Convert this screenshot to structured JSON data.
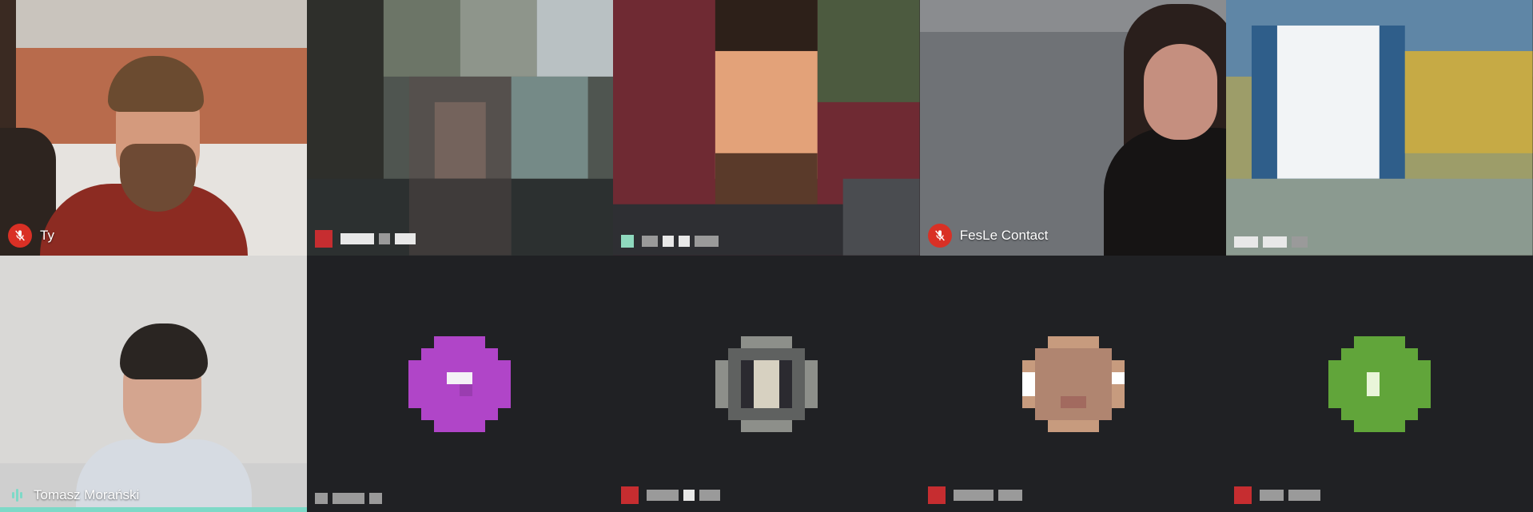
{
  "participants": [
    {
      "name": "Ty",
      "muted": true
    },
    {
      "name": "",
      "muted": true
    },
    {
      "name": "",
      "muted": false
    },
    {
      "name": "FesLe Contact",
      "muted": true
    },
    {
      "name": "",
      "muted": false
    },
    {
      "name": "Tomasz Morański",
      "muted": false,
      "speaking": true
    },
    {
      "name": "",
      "muted": false,
      "avatar_color": "#b045c8"
    },
    {
      "name": "",
      "muted": false,
      "avatar_color": "#8d8f8a"
    },
    {
      "name": "",
      "muted": true,
      "avatar_color": "#c79b7e"
    },
    {
      "name": "",
      "muted": true,
      "avatar_color": "#61a53a"
    }
  ],
  "colors": {
    "background": "#202124",
    "muted_badge": "#d93025",
    "speaking_accent": "#7ed9c7"
  },
  "icons": {
    "muted": "mic-off-icon",
    "speaking": "audio-levels-icon"
  }
}
